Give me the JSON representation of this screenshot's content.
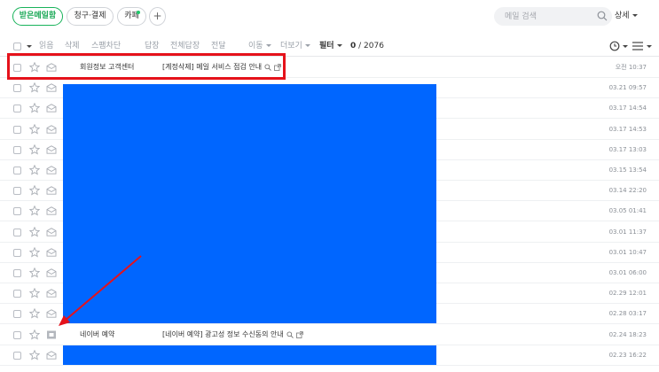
{
  "header": {
    "folders": [
      {
        "label": "받은메일함",
        "active": true
      },
      {
        "label": "청구·결제",
        "active": false
      },
      {
        "label": "카페",
        "active": false,
        "has_new": true
      }
    ],
    "add_label": "+",
    "search": {
      "placeholder": "메일 검색",
      "value": ""
    },
    "detail_label": "상세"
  },
  "toolbar": {
    "read_label": "읽음",
    "delete_label": "삭제",
    "block_label": "스팸차단",
    "reply_label": "답장",
    "reply_all_label": "전체답장",
    "forward_label": "전달",
    "move_label": "이동",
    "more_label": "더보기",
    "filter_label": "필터",
    "count": "0",
    "total": "/ 2076"
  },
  "mails": [
    {
      "sender": "회원정보 고객센터",
      "subject": "[계정삭제] 메일 서비스 점검 안내",
      "date": "오전 10:37",
      "has_actions": true
    },
    {
      "sender": "",
      "subject": "",
      "date": "03.21 09:57"
    },
    {
      "sender": "",
      "subject": "",
      "date": "03.17 14:54"
    },
    {
      "sender": "",
      "subject": "",
      "date": "03.17 14:53"
    },
    {
      "sender": "",
      "subject": "",
      "date": "03.17 13:03"
    },
    {
      "sender": "",
      "subject": "",
      "date": "03.15 13:54"
    },
    {
      "sender": "",
      "subject": "",
      "date": "03.14 22:20"
    },
    {
      "sender": "",
      "subject": "",
      "date": "03.05 01:41"
    },
    {
      "sender": "",
      "subject": "",
      "date": "03.01 11:37"
    },
    {
      "sender": "",
      "subject": "",
      "date": "03.01 10:47"
    },
    {
      "sender": "",
      "subject": "",
      "date": "03.01 06:00"
    },
    {
      "sender": "",
      "subject": "",
      "date": "02.29 12:01"
    },
    {
      "sender": "",
      "subject": "",
      "date": "02.28 03:17"
    },
    {
      "sender": "네이버 예약",
      "subject": "[네이버 예약] 광고성 정보 수신동의 안내",
      "date": "02.24 18:23",
      "has_actions": true,
      "read": true
    },
    {
      "sender": "",
      "subject": "",
      "date": "02.23 16:22"
    }
  ],
  "colors": {
    "accent": "#16a753",
    "redaction": "#0066ff",
    "annotation": "#e5121b"
  }
}
